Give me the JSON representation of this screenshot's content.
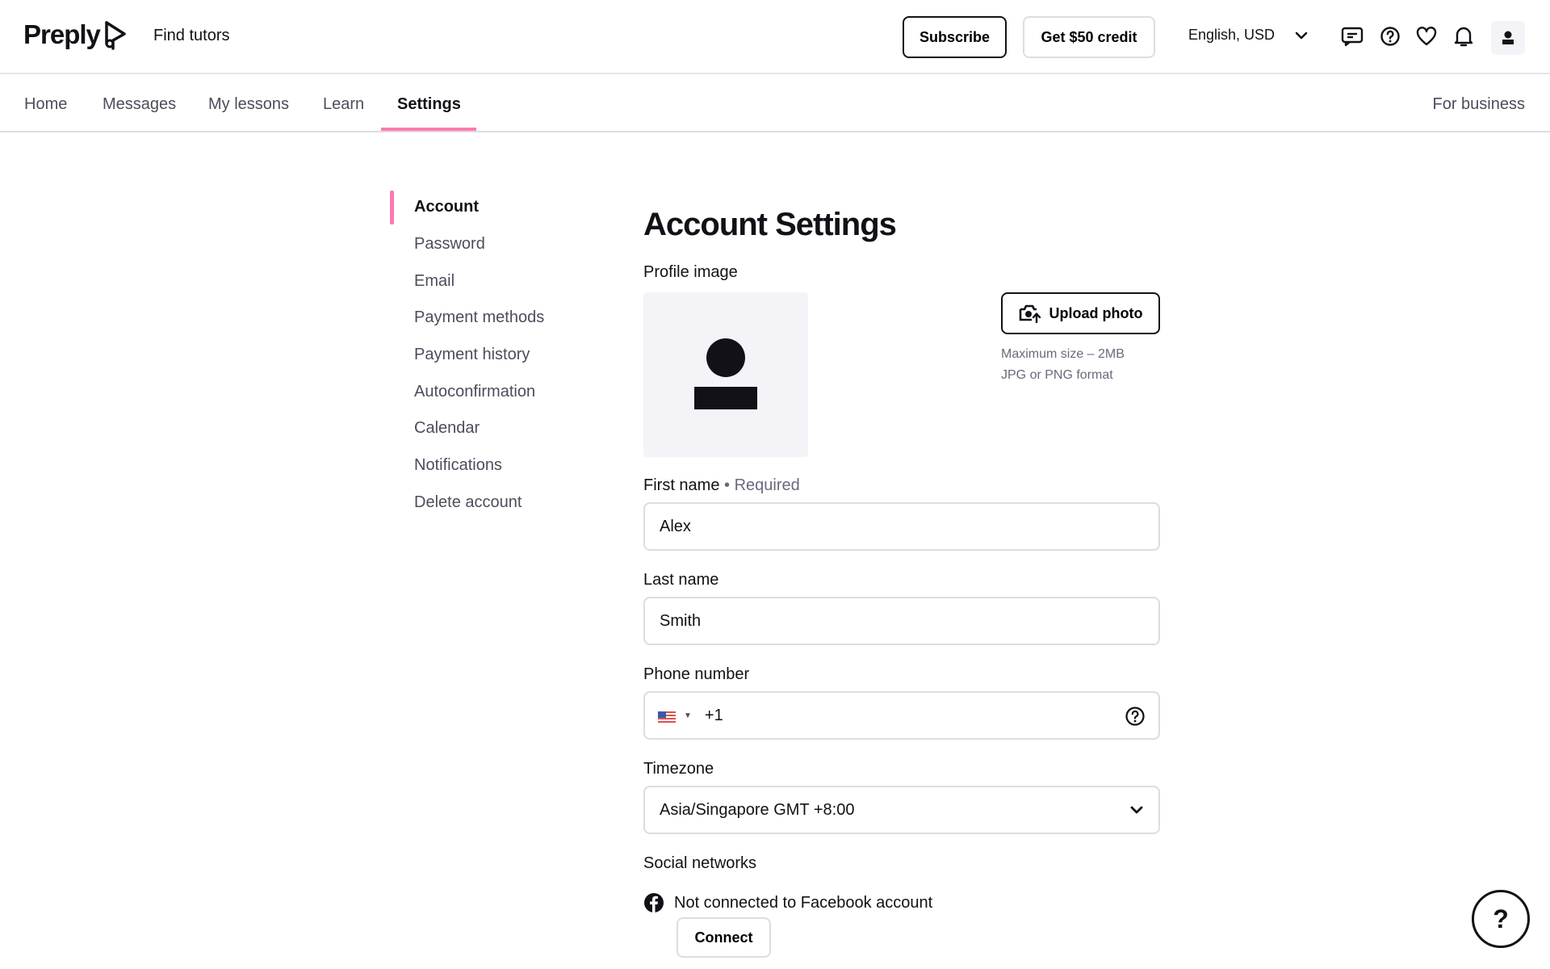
{
  "header": {
    "logo_text": "Preply",
    "find_tutors": "Find tutors",
    "subscribe_label": "Subscribe",
    "credit_label": "Get $50 credit",
    "language_currency": "English, USD"
  },
  "nav": {
    "tabs": [
      {
        "label": "Home"
      },
      {
        "label": "Messages"
      },
      {
        "label": "My lessons"
      },
      {
        "label": "Learn"
      },
      {
        "label": "Settings"
      }
    ],
    "active_tab": "Settings",
    "for_business": "For business"
  },
  "sidebar": {
    "items": [
      {
        "label": "Account"
      },
      {
        "label": "Password"
      },
      {
        "label": "Email"
      },
      {
        "label": "Payment methods"
      },
      {
        "label": "Payment history"
      },
      {
        "label": "Autoconfirmation"
      },
      {
        "label": "Calendar"
      },
      {
        "label": "Notifications"
      },
      {
        "label": "Delete account"
      }
    ],
    "active_item": "Account"
  },
  "main": {
    "title": "Account Settings",
    "profile_image_label": "Profile image",
    "upload_label": "Upload photo",
    "upload_hint_size": "Maximum size – 2MB",
    "upload_hint_format": "JPG or PNG format",
    "first_name_label": "First name",
    "required_label": "• Required",
    "first_name_value": "Alex",
    "last_name_label": "Last name",
    "last_name_value": "Smith",
    "phone_label": "Phone number",
    "phone_code": "+1",
    "timezone_label": "Timezone",
    "timezone_value": "Asia/Singapore GMT +8:00",
    "social_label": "Social networks",
    "facebook_status": "Not connected to Facebook account",
    "connect_label": "Connect"
  },
  "help_fab": "?",
  "colors": {
    "accent": "#ff7aac",
    "text": "#121117",
    "muted": "#4d4c5c",
    "border": "#dcdce5",
    "surface": "#f4f4f8"
  }
}
